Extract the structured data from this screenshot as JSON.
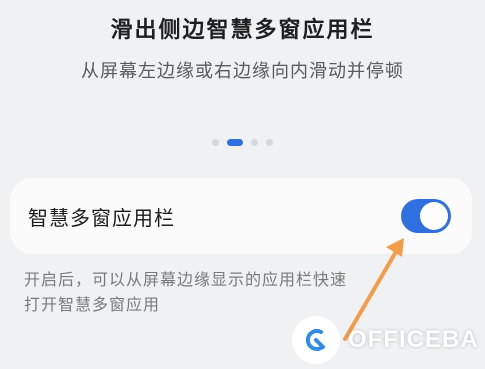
{
  "header": {
    "title": "滑出侧边智慧多窗应用栏",
    "subtitle": "从屏幕左边缘或右边缘向内滑动并停顿"
  },
  "pager": {
    "count": 4,
    "active_index": 1
  },
  "setting": {
    "label": "智慧多窗应用栏",
    "enabled": true,
    "description_line1": "开启后，可以从屏幕边缘显示的应用栏快速",
    "description_line2": "打开智慧多窗应用"
  },
  "colors": {
    "accent": "#2f6fe0",
    "arrow": "#f39c4a"
  },
  "watermark": {
    "text": "OFFICEBA",
    "icon": "officeba-logo-icon"
  }
}
